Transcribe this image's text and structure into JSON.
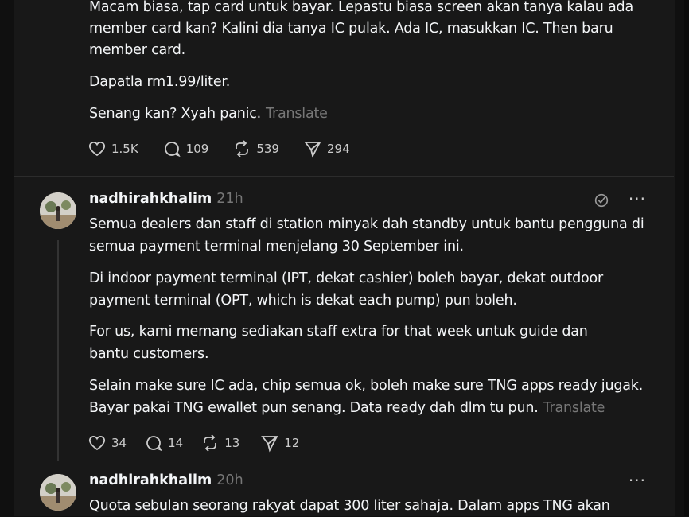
{
  "post1": {
    "lines": [
      "Macam biasa, tap card untuk bayar. Lepastu biasa screen akan tanya kalau ada",
      "member card kan? Kalini dia tanya IC pulak. Ada IC, masukkan IC. Then baru",
      "member card.",
      "Dapatla rm1.99/liter.",
      "Senang kan? Xyah panic."
    ],
    "translate": "Translate",
    "likes": "1.5K",
    "replies": "109",
    "reposts": "539",
    "shares": "294"
  },
  "post2": {
    "username": "nadhirahkhalim",
    "time": "21h",
    "lines": [
      "Semua dealers dan staff di station minyak dah standby untuk bantu pengguna di",
      "semua payment terminal menjelang 30 September ini.",
      "Di indoor payment terminal (IPT, dekat cashier) boleh bayar, dekat outdoor",
      "payment terminal (OPT, which is dekat each pump) pun boleh.",
      "For us, kami memang sediakan staff extra for that week untuk guide dan",
      "bantu customers.",
      "Selain make sure IC ada, chip semua ok, boleh make sure TNG apps ready jugak.",
      "Bayar pakai TNG ewallet pun senang. Data ready dah dlm tu pun."
    ],
    "translate": "Translate",
    "likes": "34",
    "replies": "14",
    "reposts": "13",
    "shares": "12"
  },
  "post3": {
    "username": "nadhirahkhalim",
    "time": "20h",
    "lines": [
      "Quota sebulan seorang rakyat dapat 300 liter sahaja. Dalam apps TNG akan"
    ]
  },
  "icons": [
    "heart-icon",
    "comment-icon",
    "repost-icon",
    "share-icon",
    "more-icon",
    "translate-icon"
  ]
}
